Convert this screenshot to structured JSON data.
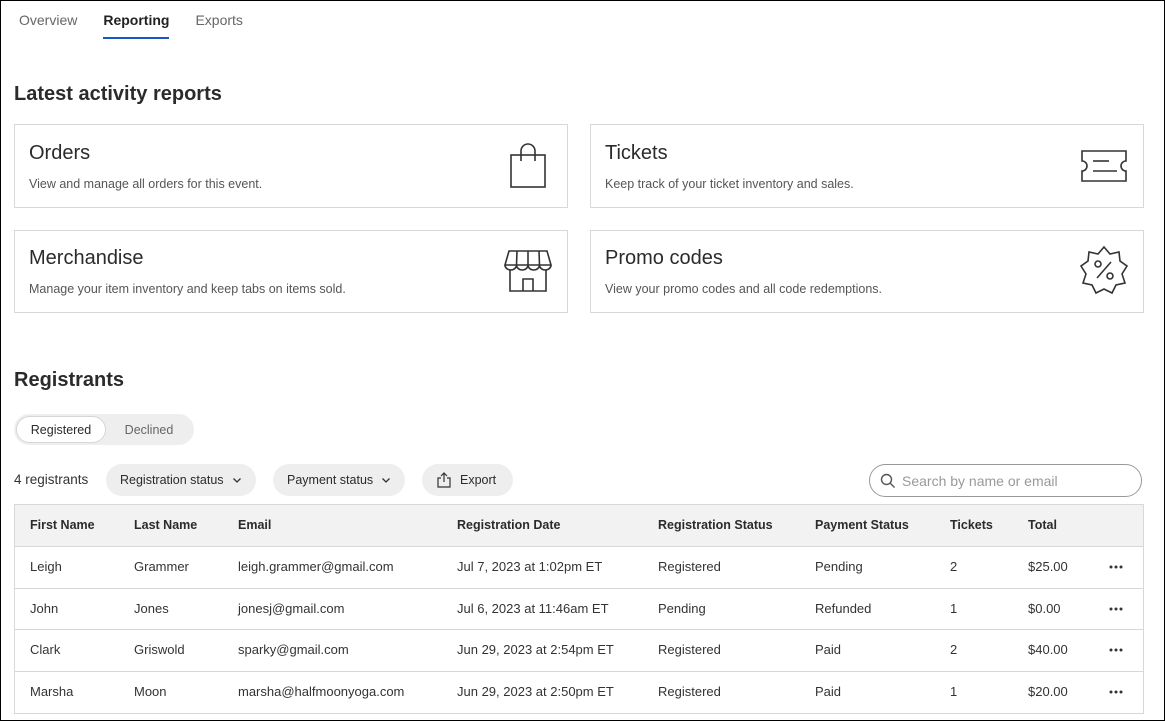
{
  "tabs": [
    {
      "label": "Overview"
    },
    {
      "label": "Reporting"
    },
    {
      "label": "Exports"
    }
  ],
  "activity": {
    "title": "Latest activity reports",
    "cards": [
      {
        "title": "Orders",
        "description": "View and manage all orders for this event.",
        "icon": "shopping-bag-icon"
      },
      {
        "title": "Tickets",
        "description": "Keep track of your ticket inventory and sales.",
        "icon": "ticket-icon"
      },
      {
        "title": "Merchandise",
        "description": "Manage your item inventory and keep tabs on items sold.",
        "icon": "storefront-icon"
      },
      {
        "title": "Promo codes",
        "description": "View your promo codes and all code redemptions.",
        "icon": "percent-badge-icon"
      }
    ]
  },
  "registrants": {
    "title": "Registrants",
    "toggle": {
      "registered": "Registered",
      "declined": "Declined",
      "selected": "Registered"
    },
    "count_label": "4 registrants",
    "filters": {
      "registration_status": "Registration status",
      "payment_status": "Payment status",
      "export": "Export"
    },
    "search": {
      "placeholder": "Search by name or email",
      "value": ""
    },
    "columns": [
      "First Name",
      "Last Name",
      "Email",
      "Registration Date",
      "Registration Status",
      "Payment Status",
      "Tickets",
      "Total"
    ],
    "rows": [
      {
        "first": "Leigh",
        "last": "Grammer",
        "email": "leigh.grammer@gmail.com",
        "date": "Jul 7, 2023 at 1:02pm ET",
        "reg_status": "Registered",
        "pay_status": "Pending",
        "tickets": "2",
        "total": "$25.00"
      },
      {
        "first": "John",
        "last": "Jones",
        "email": "jonesj@gmail.com",
        "date": "Jul 6, 2023 at 11:46am ET",
        "reg_status": "Pending",
        "pay_status": "Refunded",
        "tickets": "1",
        "total": "$0.00"
      },
      {
        "first": "Clark",
        "last": "Griswold",
        "email": "sparky@gmail.com",
        "date": "Jun 29, 2023 at 2:54pm ET",
        "reg_status": "Registered",
        "pay_status": "Paid",
        "tickets": "2",
        "total": "$40.00"
      },
      {
        "first": "Marsha",
        "last": "Moon",
        "email": "marsha@halfmoonyoga.com",
        "date": "Jun 29, 2023 at 2:50pm ET",
        "reg_status": "Registered",
        "pay_status": "Paid",
        "tickets": "1",
        "total": "$20.00"
      }
    ]
  },
  "colors": {
    "tab_underline": "#1a56c4",
    "pill_bg": "#eeeeee",
    "header_bg": "#f2f2f2"
  }
}
